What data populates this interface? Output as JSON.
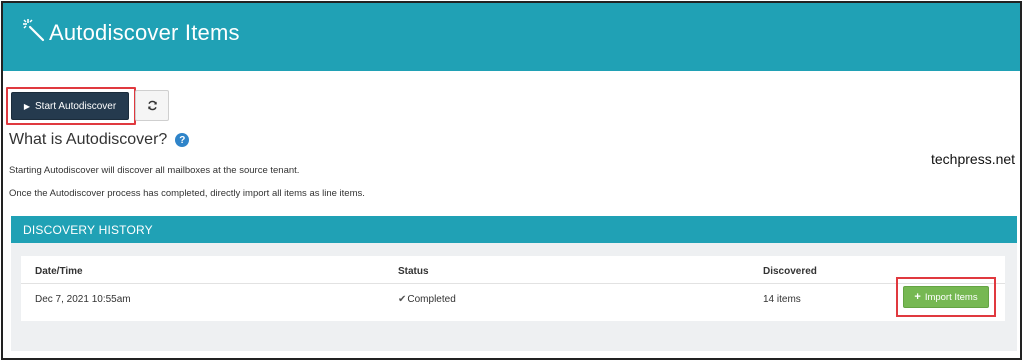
{
  "header": {
    "title": "Autodiscover Items",
    "icon": "magic-wand-icon"
  },
  "toolbar": {
    "start_label": "Start Autodiscover",
    "start_icon": "play-icon",
    "refresh_icon": "refresh-icon"
  },
  "intro": {
    "title": "What is Autodiscover?",
    "help_icon_glyph": "?",
    "line1": "Starting Autodiscover will discover all mailboxes at the source tenant.",
    "line2": "Once the Autodiscover process has completed, directly import all items as line items."
  },
  "watermark": "techpress.net",
  "history": {
    "title": "DISCOVERY HISTORY",
    "columns": {
      "datetime": "Date/Time",
      "status": "Status",
      "discovered": "Discovered"
    },
    "rows": [
      {
        "datetime": "Dec 7, 2021 10:55am",
        "status": "Completed",
        "discovered": "14 items",
        "action": "Import Items"
      }
    ]
  },
  "colors": {
    "header_bg": "#20a1b5",
    "start_button": "#253a4e",
    "import_button": "#76b852",
    "highlight": "#e0393f"
  }
}
